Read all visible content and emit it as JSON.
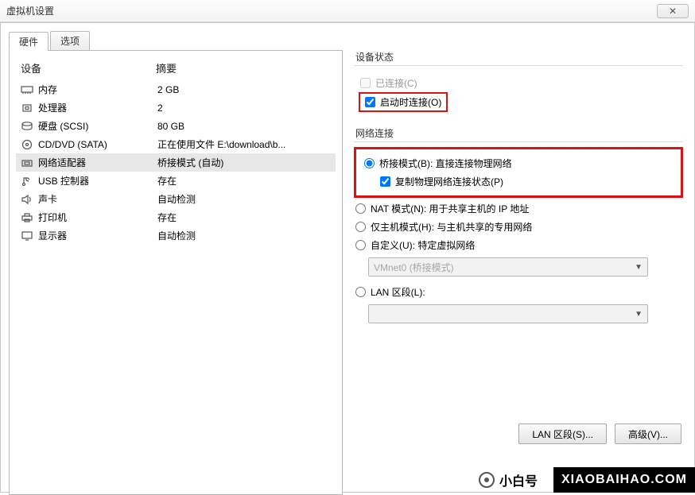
{
  "window": {
    "title": "虚拟机设置",
    "close_glyph": "✕"
  },
  "tabs": {
    "hardware": "硬件",
    "options": "选项"
  },
  "left": {
    "header_device": "设备",
    "header_summary": "摘要",
    "rows": [
      {
        "icon": "memory",
        "name": "内存",
        "summary": "2 GB"
      },
      {
        "icon": "cpu",
        "name": "处理器",
        "summary": "2"
      },
      {
        "icon": "hdd",
        "name": "硬盘 (SCSI)",
        "summary": "80 GB"
      },
      {
        "icon": "disc",
        "name": "CD/DVD (SATA)",
        "summary": "正在使用文件 E:\\download\\b..."
      },
      {
        "icon": "nic",
        "name": "网络适配器",
        "summary": "桥接模式 (自动)"
      },
      {
        "icon": "usb",
        "name": "USB 控制器",
        "summary": "存在"
      },
      {
        "icon": "sound",
        "name": "声卡",
        "summary": "自动检测"
      },
      {
        "icon": "printer",
        "name": "打印机",
        "summary": "存在"
      },
      {
        "icon": "display",
        "name": "显示器",
        "summary": "自动检测"
      }
    ]
  },
  "right": {
    "dev_state_title": "设备状态",
    "connected": "已连接(C)",
    "connect_on_power": "启动时连接(O)",
    "net_conn_title": "网络连接",
    "bridged": "桥接模式(B): 直接连接物理网络",
    "replicate": "复制物理网络连接状态(P)",
    "nat": "NAT 模式(N): 用于共享主机的 IP 地址",
    "hostonly": "仅主机模式(H): 与主机共享的专用网络",
    "custom": "自定义(U): 特定虚拟网络",
    "vmnet_sel": "VMnet0 (桥接模式)",
    "lan": "LAN 区段(L):",
    "lan_sel": "",
    "btn_lan": "LAN 区段(S)...",
    "btn_adv": "高级(V)..."
  },
  "watermark": {
    "line1": "@小白号",
    "line2": "XIAOBAIHAO.COM"
  },
  "brand": {
    "pre": "小白号",
    "text": "XIAOBAIHAO.COM"
  }
}
